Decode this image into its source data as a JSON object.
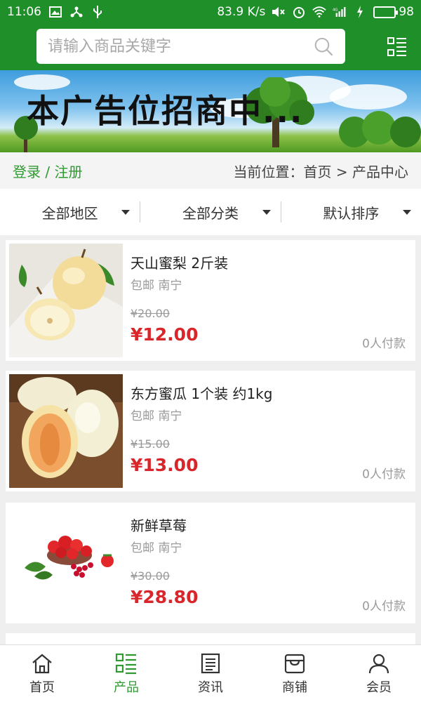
{
  "status_bar": {
    "time": "11:06",
    "net_speed": "83.9 K/s",
    "network": "4G",
    "battery": "98"
  },
  "search": {
    "placeholder": "请输入商品关键字"
  },
  "banner": {
    "text": "本广告位招商中..."
  },
  "login_bar": {
    "login": "登录",
    "separator": " / ",
    "register": "注册",
    "location": "当前位置：首页 > 产品中心"
  },
  "filters": [
    "全部地区",
    "全部分类",
    "默认排序"
  ],
  "products": [
    {
      "name": "天山蜜梨 2斤装",
      "meta": "包邮 南宁",
      "old_price": "¥20.00",
      "price": "¥12.00",
      "sold": "0人付款"
    },
    {
      "name": "东方蜜瓜 1个装 约1kg",
      "meta": "包邮 南宁",
      "old_price": "¥15.00",
      "price": "¥13.00",
      "sold": "0人付款"
    },
    {
      "name": "新鲜草莓",
      "meta": "包邮 南宁",
      "old_price": "¥30.00",
      "price": "¥28.80",
      "sold": "0人付款"
    }
  ],
  "bottom_nav": [
    {
      "label": "首页",
      "icon": "home-icon"
    },
    {
      "label": "产品",
      "icon": "list-icon",
      "active": true
    },
    {
      "label": "资讯",
      "icon": "news-icon"
    },
    {
      "label": "商铺",
      "icon": "store-icon"
    },
    {
      "label": "会员",
      "icon": "user-icon"
    }
  ],
  "colors": {
    "brand_green": "#1f8f2a",
    "price_red": "#d8262b",
    "link_green": "#2e9a2f"
  }
}
